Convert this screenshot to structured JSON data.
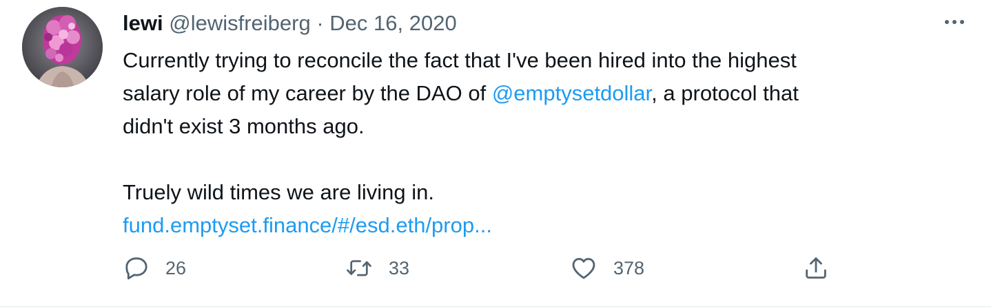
{
  "tweet": {
    "display_name": "lewi",
    "handle": "@lewisfreiberg",
    "separator": "·",
    "date": "Dec 16, 2020",
    "text": {
      "line1": "Currently trying to reconcile the fact that I've been hired into the highest",
      "line2_before": "salary role of my career by the DAO of ",
      "mention": "@emptysetdollar",
      "line2_after": ", a protocol that",
      "line3": "didn't exist 3 months ago.",
      "line4": "Truely wild times we are living in.",
      "url": "fund.emptyset.finance/#/esd.eth/prop..."
    },
    "actions": {
      "reply_count": "26",
      "retweet_count": "33",
      "like_count": "378"
    }
  },
  "icons": {
    "more": "more-horizontal-icon",
    "reply": "reply-icon",
    "retweet": "retweet-icon",
    "like": "heart-icon",
    "share": "share-icon"
  },
  "colors": {
    "link": "#1d9bf0",
    "secondary_text": "#536471",
    "primary_text": "#0f1419",
    "divider": "#eff3f4"
  }
}
